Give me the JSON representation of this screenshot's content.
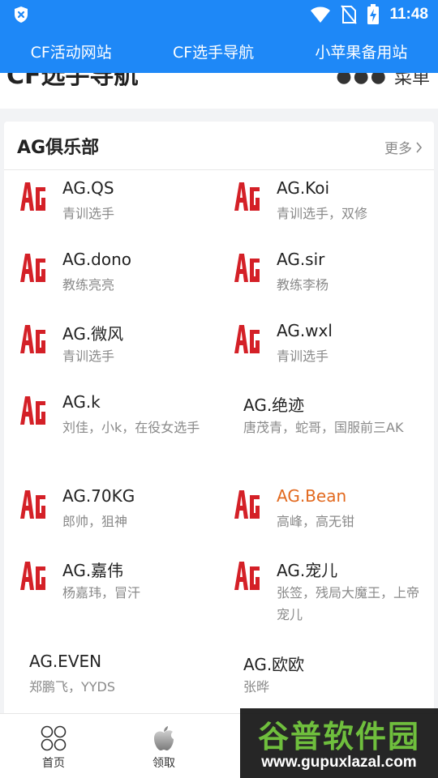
{
  "status_bar": {
    "time": "11:48"
  },
  "top_tabs": [
    {
      "label": "CF活动网站"
    },
    {
      "label": "CF选手导航"
    },
    {
      "label": "小苹果备用站"
    }
  ],
  "peek_header": {
    "title": "CF选手导航",
    "menu_label": "菜单"
  },
  "club": {
    "title": "AG俱乐部",
    "more_label": "更多",
    "players": [
      {
        "name": "AG.QS",
        "desc": "青训选手",
        "logo": true
      },
      {
        "name": "AG.Koi",
        "desc": "青训选手，双修",
        "logo": true
      },
      {
        "name": "AG.dono",
        "desc": "教练亮亮",
        "logo": true
      },
      {
        "name": "AG.sir",
        "desc": "教练李杨",
        "logo": true
      },
      {
        "name": "AG.微风",
        "desc": "青训选手",
        "logo": true
      },
      {
        "name": "AG.wxl",
        "desc": "青训选手",
        "logo": true
      },
      {
        "name": "AG.k",
        "desc": "刘佳，小k，在役女选手",
        "logo": true
      },
      {
        "name": "AG.绝迹",
        "desc": "唐茂青，蛇哥，国服前三AK",
        "logo": false
      },
      {
        "name": "AG.70KG",
        "desc": "郎帅，狙神",
        "logo": true
      },
      {
        "name": "AG.Bean",
        "desc": "高峰，高无钳",
        "logo": true,
        "highlight_color": "#e2691e"
      },
      {
        "name": "AG.嘉伟",
        "desc": "杨嘉玮，冒汗",
        "logo": true
      },
      {
        "name": "AG.宠儿",
        "desc": "张签，残局大魔王，上帝宠儿",
        "logo": true
      },
      {
        "name": "AG.EVEN",
        "desc": "郑鹏飞，YYDS",
        "logo": false
      },
      {
        "name": "AG.欧欧",
        "desc": "张晔",
        "logo": false
      }
    ]
  },
  "bottom_nav": [
    {
      "label": "首页",
      "icon": "grid-icon"
    },
    {
      "label": "领取",
      "icon": "apple-icon"
    }
  ],
  "watermark": {
    "title": "谷普软件园",
    "url": "www.gupuxlazal.com"
  },
  "colors": {
    "accent": "#1e88f7",
    "logo_red": "#d42027",
    "highlight": "#e2691e"
  }
}
